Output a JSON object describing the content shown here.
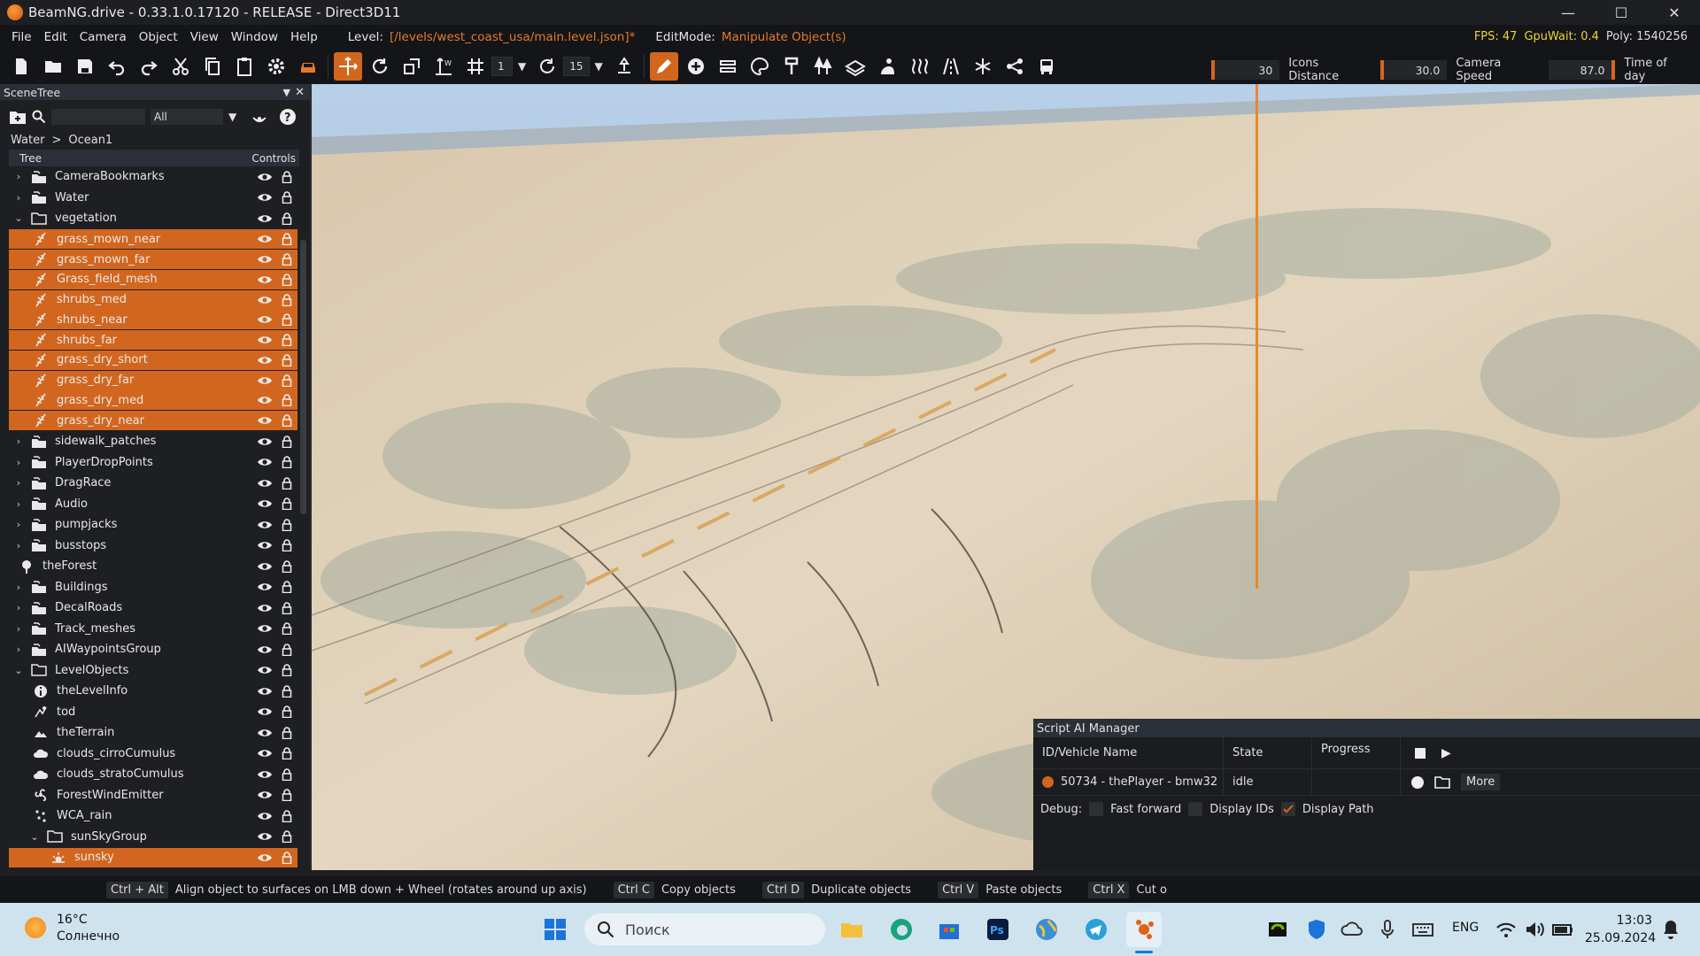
{
  "window": {
    "title": "BeamNG.drive - 0.33.1.0.17120 - RELEASE - Direct3D11"
  },
  "menu": {
    "items": [
      "File",
      "Edit",
      "Camera",
      "Object",
      "View",
      "Window",
      "Help"
    ],
    "level_label": "Level:",
    "level_path": "[/levels/west_coast_usa/main.level.json]*",
    "editmode_label": "EditMode:",
    "editmode_value": "Manipulate Object(s)",
    "fps": "FPS: 47",
    "gpuwait": "GpuWait: 0.4",
    "poly": "Poly: 1540256"
  },
  "toolbar": {
    "snap_value": "1",
    "rotate_value": "15",
    "icon_size": "30",
    "icons_distance_label": "Icons Distance",
    "icons_distance": "30.0",
    "camera_speed_label": "Camera Speed",
    "camera_speed": "87.0",
    "time_of_day_label": "Time of day"
  },
  "scenetree": {
    "title": "SceneTree",
    "filter": "All",
    "breadcrumb": [
      "Water",
      ">",
      "Ocean1"
    ],
    "col_tree": "Tree",
    "col_controls": "Controls",
    "rows": [
      {
        "label": "CameraBookmarks",
        "level": 0,
        "arrow": "›",
        "icon": "group",
        "sel": false
      },
      {
        "label": "Water",
        "level": 0,
        "arrow": "›",
        "icon": "group",
        "sel": false
      },
      {
        "label": "vegetation",
        "level": 0,
        "arrow": "⌄",
        "icon": "folder",
        "sel": false
      },
      {
        "label": "grass_mown_near",
        "level": 1,
        "arrow": "",
        "icon": "forest",
        "sel": true
      },
      {
        "label": "grass_mown_far",
        "level": 1,
        "arrow": "",
        "icon": "forest",
        "sel": true
      },
      {
        "label": "Grass_field_mesh",
        "level": 1,
        "arrow": "",
        "icon": "forest",
        "sel": true
      },
      {
        "label": "shrubs_med",
        "level": 1,
        "arrow": "",
        "icon": "forest",
        "sel": true
      },
      {
        "label": "shrubs_near",
        "level": 1,
        "arrow": "",
        "icon": "forest",
        "sel": true
      },
      {
        "label": "shrubs_far",
        "level": 1,
        "arrow": "",
        "icon": "forest",
        "sel": true
      },
      {
        "label": "grass_dry_short",
        "level": 1,
        "arrow": "",
        "icon": "forest",
        "sel": true
      },
      {
        "label": "grass_dry_far",
        "level": 1,
        "arrow": "",
        "icon": "forest",
        "sel": true
      },
      {
        "label": "grass_dry_med",
        "level": 1,
        "arrow": "",
        "icon": "forest",
        "sel": true
      },
      {
        "label": "grass_dry_near",
        "level": 1,
        "arrow": "",
        "icon": "forest",
        "sel": true
      },
      {
        "label": "sidewalk_patches",
        "level": 0,
        "arrow": "›",
        "icon": "group",
        "sel": false
      },
      {
        "label": "PlayerDropPoints",
        "level": 0,
        "arrow": "›",
        "icon": "group",
        "sel": false
      },
      {
        "label": "DragRace",
        "level": 0,
        "arrow": "›",
        "icon": "group",
        "sel": false
      },
      {
        "label": "Audio",
        "level": 0,
        "arrow": "›",
        "icon": "group",
        "sel": false
      },
      {
        "label": "pumpjacks",
        "level": 0,
        "arrow": "›",
        "icon": "group",
        "sel": false
      },
      {
        "label": "busstops",
        "level": 0,
        "arrow": "›",
        "icon": "group",
        "sel": false
      },
      {
        "label": "theForest",
        "level": -1,
        "arrow": "",
        "icon": "tree",
        "sel": false
      },
      {
        "label": "Buildings",
        "level": 0,
        "arrow": "›",
        "icon": "group",
        "sel": false
      },
      {
        "label": "DecalRoads",
        "level": 0,
        "arrow": "›",
        "icon": "group",
        "sel": false
      },
      {
        "label": "Track_meshes",
        "level": 0,
        "arrow": "›",
        "icon": "group",
        "sel": false
      },
      {
        "label": "AIWaypointsGroup",
        "level": 0,
        "arrow": "›",
        "icon": "group",
        "sel": false
      },
      {
        "label": "LevelObjects",
        "level": 0,
        "arrow": "⌄",
        "icon": "folder",
        "sel": false
      },
      {
        "label": "theLevelInfo",
        "level": 1,
        "arrow": "",
        "icon": "info",
        "sel": false
      },
      {
        "label": "tod",
        "level": 1,
        "arrow": "",
        "icon": "tod",
        "sel": false
      },
      {
        "label": "theTerrain",
        "level": 1,
        "arrow": "",
        "icon": "terrain",
        "sel": false
      },
      {
        "label": "clouds_cirroCumulus",
        "level": 1,
        "arrow": "",
        "icon": "cloud",
        "sel": false
      },
      {
        "label": "clouds_stratoCumulus",
        "level": 1,
        "arrow": "",
        "icon": "cloud",
        "sel": false
      },
      {
        "label": "ForestWindEmitter",
        "level": 1,
        "arrow": "",
        "icon": "wind",
        "sel": false
      },
      {
        "label": "WCA_rain",
        "level": 1,
        "arrow": "",
        "icon": "rain",
        "sel": false
      },
      {
        "label": "sunSkyGroup",
        "level": 2,
        "arrow": "⌄",
        "icon": "folder",
        "sel": false
      },
      {
        "label": "sunsky",
        "level": 3,
        "arrow": "",
        "icon": "sun",
        "sel": true
      }
    ]
  },
  "aimanager": {
    "title": "Script AI Manager",
    "col_id": "ID/Vehicle Name",
    "col_state": "State",
    "col_progress": "Progress",
    "vehicle": "50734 - thePlayer - bmw32",
    "state": "idle",
    "more_label": "More",
    "debug_label": "Debug:",
    "fast_forward": "Fast forward",
    "display_ids": "Display IDs",
    "display_path": "Display Path"
  },
  "statusbar": {
    "hints": [
      {
        "key": "Ctrl + Alt",
        "text": "Align object to surfaces on LMB down + Wheel (rotates around up axis)"
      },
      {
        "key": "Ctrl C",
        "text": "Copy objects"
      },
      {
        "key": "Ctrl D",
        "text": "Duplicate objects"
      },
      {
        "key": "Ctrl V",
        "text": "Paste objects"
      },
      {
        "key": "Ctrl X",
        "text": "Cut o"
      }
    ]
  },
  "taskbar": {
    "temp": "16°C",
    "weather": "Солнечно",
    "search": "Поиск",
    "lang": "ENG",
    "time": "13:03",
    "date": "25.09.2024"
  },
  "colors": {
    "accent": "#d3661e",
    "panel": "#1e1f22",
    "sky": "#8fb2d0"
  }
}
